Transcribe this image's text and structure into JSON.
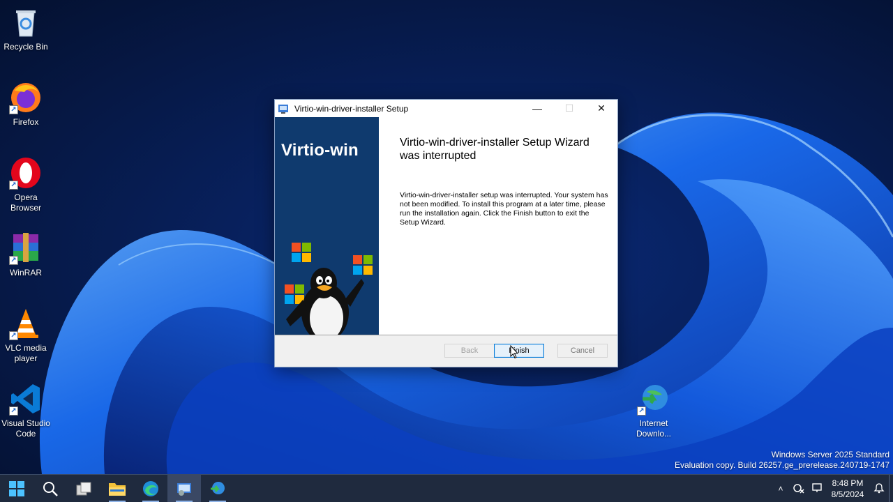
{
  "desktop": {
    "icons": [
      {
        "label_line1": "Recycle Bin",
        "label_line2": ""
      },
      {
        "label_line1": "Firefox",
        "label_line2": ""
      },
      {
        "label_line1": "Opera",
        "label_line2": "Browser"
      },
      {
        "label_line1": "WinRAR",
        "label_line2": ""
      },
      {
        "label_line1": "VLC media",
        "label_line2": "player"
      },
      {
        "label_line1": "Visual Studio",
        "label_line2": "Code"
      },
      {
        "label_line1": "Internet",
        "label_line2": "Downlo..."
      }
    ],
    "shortcut_arrow": "↗"
  },
  "dialog": {
    "title": "Virtio-win-driver-installer Setup",
    "controls": {
      "minimize": "—",
      "maximize": "☐",
      "close": "✕"
    },
    "banner_title": "Virtio-win",
    "heading": "Virtio-win-driver-installer Setup Wizard was interrupted",
    "body": "Virtio-win-driver-installer setup was interrupted. Your system has not been modified. To install this program at a later time, please run the installation again. Click the Finish button to exit the Setup Wizard.",
    "buttons": {
      "back": "Back",
      "finish": "Finish",
      "cancel": "Cancel"
    }
  },
  "watermark": {
    "line1": "Windows Server 2025 Standard",
    "line2": "Evaluation copy. Build 26257.ge_prerelease.240719-1747"
  },
  "taskbar": {
    "tray": {
      "chevron": "˄",
      "time": "8:48 PM",
      "date": "8/5/2024"
    }
  },
  "colors": {
    "taskbar_bg": "#1f2a3e",
    "banner_bg": "#0f3a6e",
    "accent": "#0078d7"
  }
}
